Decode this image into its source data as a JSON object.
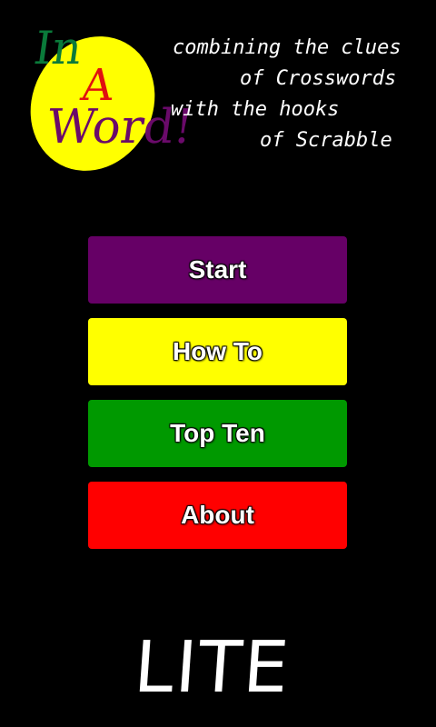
{
  "logo": {
    "part1": "In",
    "part2": "A",
    "part3": "Word!"
  },
  "tagline": {
    "line1": "combining the clues",
    "line2": "of Crosswords",
    "line3": "with the hooks",
    "line4": "of Scrabble"
  },
  "menu": {
    "buttons": [
      {
        "label": "Start",
        "color": "#660066"
      },
      {
        "label": "How To",
        "color": "#ffff00"
      },
      {
        "label": "Top Ten",
        "color": "#009900"
      },
      {
        "label": "About",
        "color": "#ff0000"
      }
    ]
  },
  "footer": {
    "edition": "LITE"
  }
}
